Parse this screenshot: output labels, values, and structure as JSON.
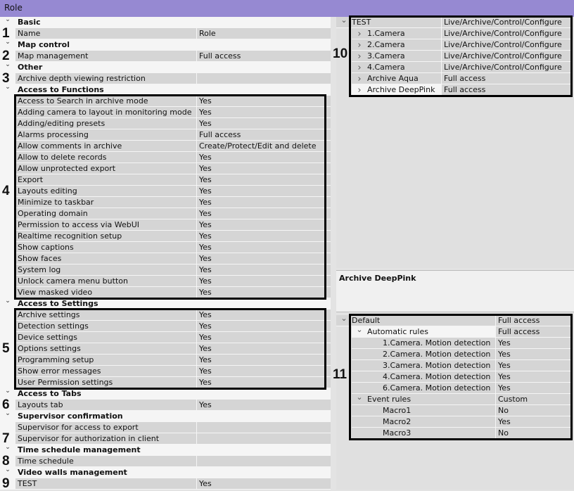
{
  "window": {
    "title": "Role"
  },
  "left": [
    {
      "h": "Basic"
    },
    {
      "k": "Name",
      "v": "Role",
      "n": "1"
    },
    {
      "h": "Map control"
    },
    {
      "k": "Map management",
      "v": "Full access",
      "n": "2"
    },
    {
      "h": "Other"
    },
    {
      "k": "Archive depth viewing restriction",
      "v": "",
      "n": "3"
    },
    {
      "h": "Access to Functions"
    },
    {
      "k": "Access to Search in archive mode",
      "v": "Yes"
    },
    {
      "k": "Adding camera to layout in monitoring mode",
      "v": "Yes"
    },
    {
      "k": "Adding/editing presets",
      "v": "Yes"
    },
    {
      "k": "Alarms processing",
      "v": "Full access"
    },
    {
      "k": "Allow comments in archive",
      "v": "Create/Protect/Edit and delete"
    },
    {
      "k": "Allow to delete records",
      "v": "Yes"
    },
    {
      "k": "Allow unprotected export",
      "v": "Yes"
    },
    {
      "k": "Export",
      "v": "Yes"
    },
    {
      "k": "Layouts editing",
      "v": "Yes",
      "n": "4"
    },
    {
      "k": "Minimize to taskbar",
      "v": "Yes"
    },
    {
      "k": "Operating domain",
      "v": "Yes"
    },
    {
      "k": "Permission to access via WebUI",
      "v": "Yes"
    },
    {
      "k": "Realtime recognition setup",
      "v": "Yes"
    },
    {
      "k": "Show captions",
      "v": "Yes"
    },
    {
      "k": "Show faces",
      "v": "Yes"
    },
    {
      "k": "System log",
      "v": "Yes"
    },
    {
      "k": "Unlock camera menu button",
      "v": "Yes"
    },
    {
      "k": "View masked video",
      "v": "Yes"
    },
    {
      "h": "Access to Settings"
    },
    {
      "k": "Archive settings",
      "v": "Yes"
    },
    {
      "k": "Detection settings",
      "v": "Yes"
    },
    {
      "k": "Device settings",
      "v": "Yes"
    },
    {
      "k": "Options settings",
      "v": "Yes",
      "n": "5"
    },
    {
      "k": "Programming setup",
      "v": "Yes"
    },
    {
      "k": "Show error messages",
      "v": "Yes"
    },
    {
      "k": "User Permission settings",
      "v": "Yes"
    },
    {
      "h": "Access to Tabs"
    },
    {
      "k": "Layouts tab",
      "v": "Yes",
      "n": "6"
    },
    {
      "h": "Supervisor confirmation"
    },
    {
      "k": "Supervisor for access to export",
      "v": ""
    },
    {
      "k": "Supervisor for authorization in client",
      "v": "",
      "n": "7"
    },
    {
      "h": "Time schedule management"
    },
    {
      "k": "Time schedule",
      "v": "",
      "n": "8"
    },
    {
      "h": "Video walls management"
    },
    {
      "k": "TEST",
      "v": "Yes",
      "n": "9"
    }
  ],
  "devices": {
    "label": "10",
    "rows": [
      {
        "k": "TEST",
        "v": "Live/Archive/Control/Configure",
        "lvl": 0,
        "chev": "down"
      },
      {
        "k": "1.Camera",
        "v": "Live/Archive/Control/Configure",
        "lvl": 1,
        "chev": "right"
      },
      {
        "k": "2.Camera",
        "v": "Live/Archive/Control/Configure",
        "lvl": 1,
        "chev": "right"
      },
      {
        "k": "3.Camera",
        "v": "Live/Archive/Control/Configure",
        "lvl": 1,
        "chev": "right"
      },
      {
        "k": "4.Camera",
        "v": "Live/Archive/Control/Configure",
        "lvl": 1,
        "chev": "right"
      },
      {
        "k": "Archive Aqua",
        "v": "Full access",
        "lvl": 1,
        "chev": "right"
      },
      {
        "k": "Archive DeepPink",
        "v": "Full access",
        "lvl": 1,
        "chev": "right",
        "sel": true
      }
    ]
  },
  "description": {
    "title": "Archive DeepPink"
  },
  "rules": {
    "label": "11",
    "rows": [
      {
        "k": "Default",
        "v": "Full access",
        "lvl": 0,
        "chev": "down"
      },
      {
        "k": "Automatic rules",
        "v": "Full access",
        "lvl": 1,
        "chev": "down",
        "sel": true
      },
      {
        "k": "1.Camera. Motion detection",
        "v": "Yes",
        "lvl": 2
      },
      {
        "k": "2.Camera. Motion detection",
        "v": "Yes",
        "lvl": 2
      },
      {
        "k": "3.Camera. Motion detection",
        "v": "Yes",
        "lvl": 2
      },
      {
        "k": "4.Camera. Motion detection",
        "v": "Yes",
        "lvl": 2
      },
      {
        "k": "6.Camera. Motion detection",
        "v": "Yes",
        "lvl": 2
      },
      {
        "k": "Event rules",
        "v": "Custom",
        "lvl": 1,
        "chev": "down"
      },
      {
        "k": "Macro1",
        "v": "No",
        "lvl": 2
      },
      {
        "k": "Macro2",
        "v": "Yes",
        "lvl": 2
      },
      {
        "k": "Macro3",
        "v": "No",
        "lvl": 2
      }
    ]
  }
}
